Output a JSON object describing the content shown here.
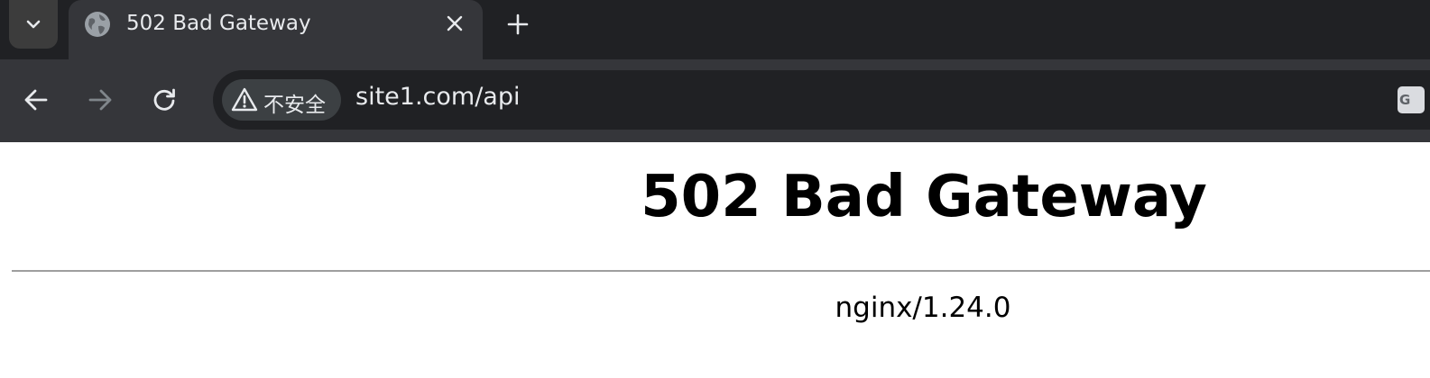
{
  "browser": {
    "tab": {
      "title": "502 Bad Gateway"
    },
    "omnibox": {
      "security_label": "不安全",
      "url": "site1.com/api"
    },
    "extension_icon_text": "G"
  },
  "page": {
    "heading": "502 Bad Gateway",
    "server_signature": "nginx/1.24.0"
  },
  "colors": {
    "tabstrip_bg": "#202124",
    "toolbar_bg": "#35363a",
    "omnibox_bg": "#202124",
    "text_light": "#e8eaed"
  }
}
